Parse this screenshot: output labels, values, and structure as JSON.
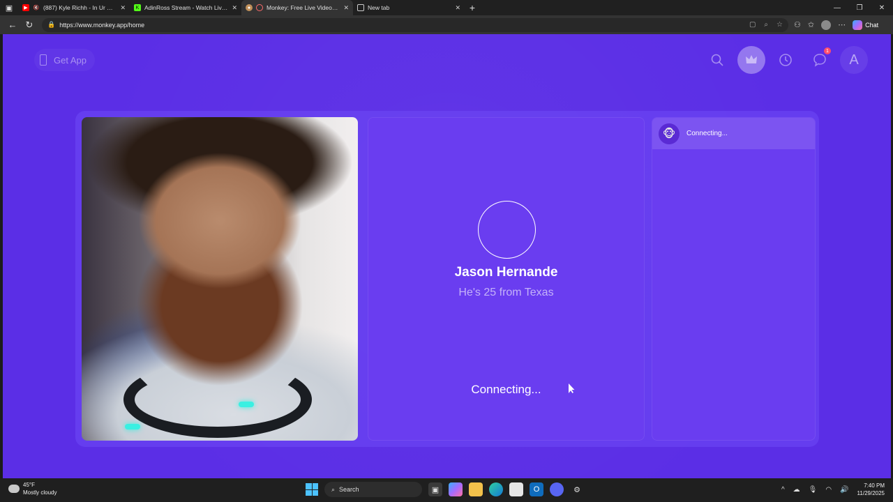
{
  "browser": {
    "tabs": [
      {
        "title": "(887) Kyle Richh - In Ur Eyes",
        "favicon_color": "#ff0000",
        "active": false
      },
      {
        "title": "AdinRoss Stream - Watch Live on",
        "favicon_color": "#53fc18",
        "active": false
      },
      {
        "title": "Monkey: Free Live Video Ch",
        "favicon_color": "#c0905a",
        "active": true
      },
      {
        "title": "New tab",
        "favicon_color": "#cccccc",
        "active": false
      }
    ],
    "url": "https://www.monkey.app/home",
    "chat_label": "Chat"
  },
  "header": {
    "get_app_label": "Get App",
    "avatar_letter": "A",
    "notification_count": "1"
  },
  "match": {
    "name": "Jason Hernande",
    "info": "He's 25 from Texas",
    "status": "Connecting..."
  },
  "chat": {
    "status": "Connecting..."
  },
  "taskbar": {
    "weather_temp": "45°F",
    "weather_desc": "Mostly cloudy",
    "search_label": "Search",
    "time": "7:40 PM",
    "date": "11/29/2025"
  },
  "colors": {
    "page_bg": "#5b2ee6",
    "panel_bg": "#6a3df0",
    "accent_badge": "#ff4d6d"
  }
}
